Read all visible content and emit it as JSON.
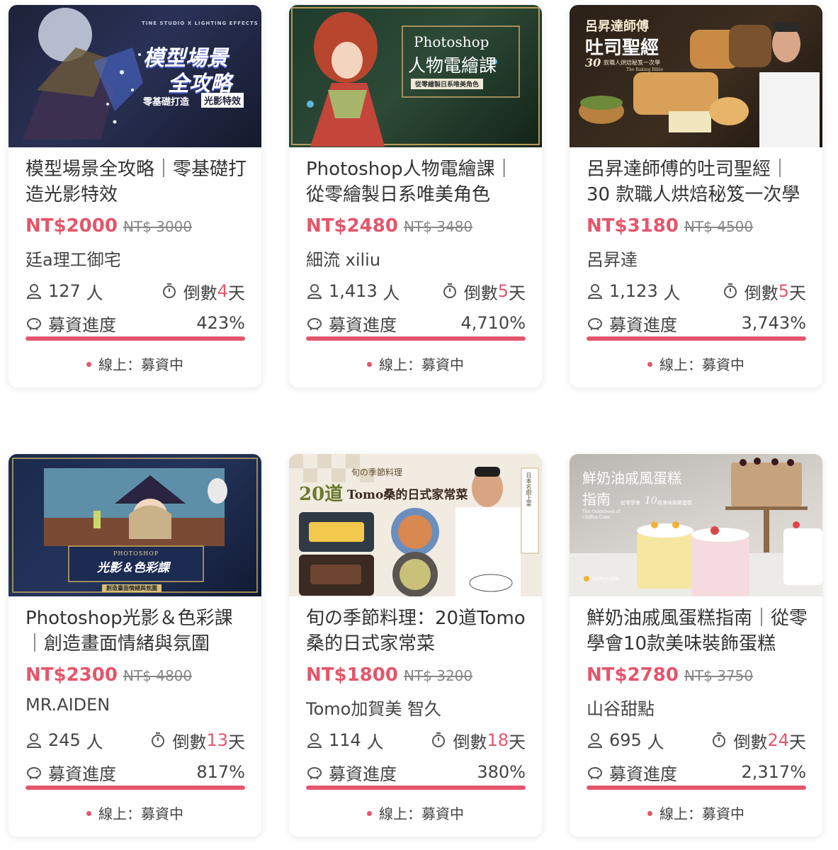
{
  "colors": {
    "accent": "#e4566b",
    "track": "#f3d6db"
  },
  "status_label": "線上：募資中",
  "progress_label": "募資進度",
  "people_unit": "人",
  "countdown_prefix": "倒數",
  "countdown_suffix": "天",
  "cards": [
    {
      "title": "模型場景全攻略｜零基礎打造光影特效",
      "price": "NT$2000",
      "original_price": "NT$ 3000",
      "author": "廷a理工御宅",
      "backers": "127",
      "days": "4",
      "progress_text": "423%",
      "progress_fill": 1.0,
      "image": {
        "top_caption": "TINE STUDIO X LIGHTING EFFECTS",
        "line1": "模型場景",
        "line2": "全攻略",
        "sub1": "零基礎打造",
        "sub2": "光影特效"
      }
    },
    {
      "title": "Photoshop人物電繪課｜從零繪製日系唯美角色",
      "price": "NT$2480",
      "original_price": "NT$ 3480",
      "author": "細流 xiliu",
      "backers": "1,413",
      "days": "5",
      "progress_text": "4,710%",
      "progress_fill": 1.0,
      "image": {
        "line1": "Photoshop",
        "line2": "人物電繪課",
        "sub1": "從零繪製日系唯美角色"
      }
    },
    {
      "title": "呂昇達師傅的吐司聖經｜30 款職人烘焙秘笈一次學",
      "price": "NT$3180",
      "original_price": "NT$ 4500",
      "author": "呂昇達",
      "backers": "1,123",
      "days": "5",
      "progress_text": "3,743%",
      "progress_fill": 1.0,
      "image": {
        "line1": "呂昇達師傅",
        "line2": "吐司聖經",
        "sub1": "30",
        "sub2": "款職人烘焙秘笈一次學",
        "sub3": "The Baking Bible"
      }
    },
    {
      "title": "Photoshop光影＆色彩課｜創造畫面情緒與氛圍",
      "price": "NT$2300",
      "original_price": "NT$ 4800",
      "author": "MR.AIDEN",
      "backers": "245",
      "days": "13",
      "progress_text": "817%",
      "progress_fill": 1.0,
      "image": {
        "line1": "PHOTOSHOP",
        "line2": "光影＆色彩課",
        "sub1": "創造畫面情緒與氛圍"
      }
    },
    {
      "title": "旬の季節料理：20道Tomo桑的日式家常菜",
      "price": "NT$1800",
      "original_price": "NT$ 3200",
      "author": "Tomo加賀美 智久",
      "backers": "114",
      "days": "18",
      "progress_text": "380%",
      "progress_fill": 1.0,
      "image": {
        "line1": "旬の季節料理",
        "line2": "20道",
        "line3": "Tomo桑的日式家常菜",
        "side": "日本名廚上菜"
      }
    },
    {
      "title": "鮮奶油戚風蛋糕指南｜從零學會10款美味裝飾蛋糕",
      "price": "NT$2780",
      "original_price": "NT$ 3750",
      "author": "山谷甜點",
      "backers": "695",
      "days": "24",
      "progress_text": "2,317%",
      "progress_fill": 1.0,
      "image": {
        "line1": "鮮奶油戚風蛋糕",
        "line2": "指南",
        "sub1": "The Guidebook of Chiffon Cake",
        "sub2": "從零學會",
        "sub3": "10",
        "sub4": "款美味裝飾蛋糕",
        "brand": "Valleycake"
      }
    }
  ]
}
